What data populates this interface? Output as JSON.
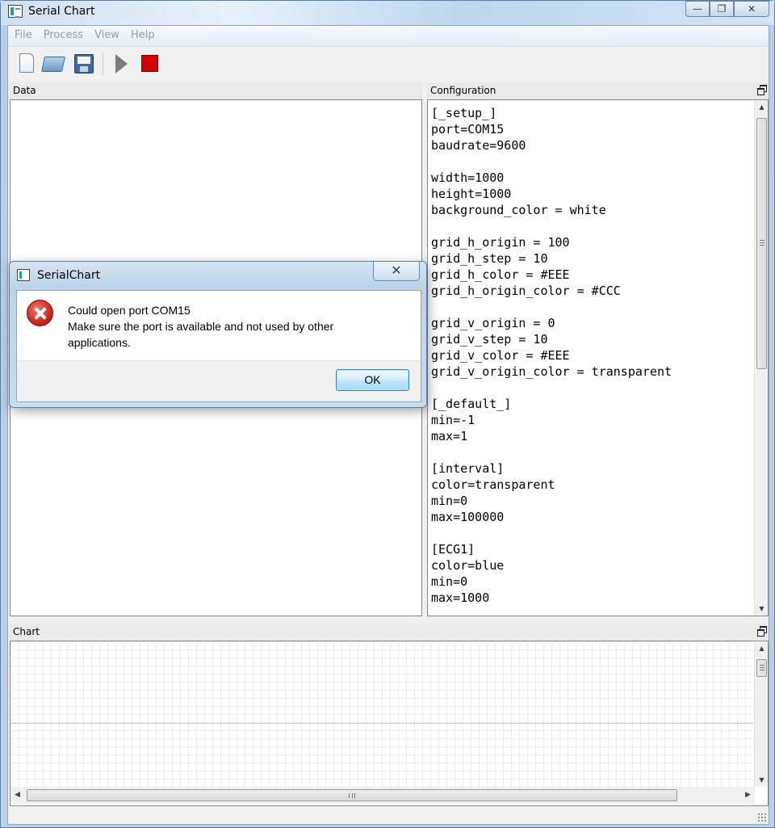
{
  "window": {
    "title": "Serial Chart",
    "minimize": "—",
    "maximize": "❐",
    "close": "✕"
  },
  "menu": [
    "File",
    "Process",
    "View",
    "Help"
  ],
  "toolbar": {
    "icons": [
      "new-file-icon",
      "open-folder-icon",
      "save-disk-icon",
      "run-icon",
      "stop-icon"
    ]
  },
  "panels": {
    "data_title": "Data",
    "config_title": "Configuration",
    "chart_title": "Chart"
  },
  "configuration_lines": [
    "[_setup_]",
    "port=COM15",
    "baudrate=9600",
    "",
    "width=1000",
    "height=1000",
    "background_color = white",
    "",
    "grid_h_origin = 100",
    "grid_h_step = 10",
    "grid_h_color = #EEE",
    "grid_h_origin_color = #CCC",
    "",
    "grid_v_origin = 0",
    "grid_v_step = 10",
    "grid_v_color = #EEE",
    "grid_v_origin_color = transparent",
    "",
    "[_default_]",
    "min=-1",
    "max=1",
    "",
    "[interval]",
    "color=transparent",
    "min=0",
    "max=100000",
    "",
    "[ECG1]",
    "color=blue",
    "min=0",
    "max=1000"
  ],
  "dialog": {
    "title": "SerialChart",
    "close": "✕",
    "message_line1": "Could open port COM15",
    "message_line2": "Make sure the port is available and not used by other",
    "message_line3": "applications.",
    "ok_label": "OK"
  },
  "scroll": {
    "up": "▲",
    "down": "▼",
    "left": "◀",
    "right": "▶"
  },
  "colors": {
    "grid": "#EEE",
    "grid_origin": "#CCC",
    "stop_red": "#D10000"
  }
}
